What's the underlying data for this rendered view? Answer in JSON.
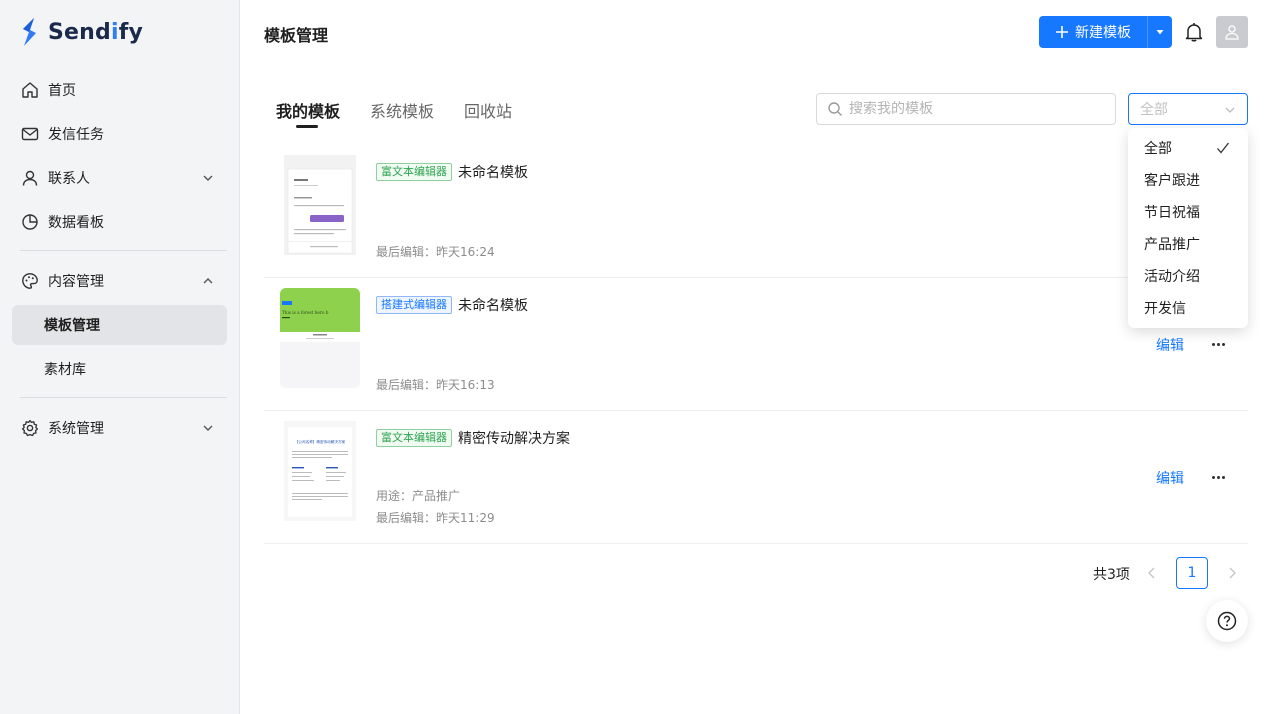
{
  "brand": {
    "name_prefix": "Send",
    "name_mid": "i",
    "name_suffix": "fy",
    "accent": "#2f7cf6"
  },
  "sidebar": {
    "items": [
      {
        "label": "首页",
        "icon": "home-icon"
      },
      {
        "label": "发信任务",
        "icon": "mail-icon"
      },
      {
        "label": "联系人",
        "icon": "user-icon",
        "expandable": true
      },
      {
        "label": "数据看板",
        "icon": "pie-chart-icon"
      },
      {
        "label": "内容管理",
        "icon": "palette-icon",
        "expanded": true
      },
      {
        "label": "模板管理",
        "sub": true,
        "active": true
      },
      {
        "label": "素材库",
        "sub": true
      },
      {
        "label": "系统管理",
        "icon": "gear-icon",
        "expandable": true
      }
    ]
  },
  "header": {
    "title": "模板管理",
    "new_button": "新建模板"
  },
  "tabs": [
    {
      "label": "我的模板",
      "active": true
    },
    {
      "label": "系统模板"
    },
    {
      "label": "回收站"
    }
  ],
  "search": {
    "placeholder": "搜索我的模板"
  },
  "filter": {
    "placeholder": "全部",
    "options": [
      "全部",
      "客户跟进",
      "节日祝福",
      "产品推广",
      "活动介绍",
      "开发信"
    ],
    "selected": "全部"
  },
  "templates": [
    {
      "tag": "富文本编辑器",
      "tag_color": "green",
      "name": "未命名模板",
      "last_edit": "最后编辑：昨天16:24"
    },
    {
      "tag": "搭建式编辑器",
      "tag_color": "blue",
      "name": "未命名模板",
      "last_edit": "最后编辑：昨天16:13",
      "edit": "编辑"
    },
    {
      "tag": "富文本编辑器",
      "tag_color": "green",
      "name": "精密传动解决方案",
      "usage": "用途：产品推广",
      "last_edit": "最后编辑：昨天11:29",
      "edit": "编辑"
    }
  ],
  "thumbs": {
    "t2_banner_text": "This is a forest hero b",
    "t3_heading": "【公司名称】精密传动解决方案"
  },
  "pagination": {
    "total": "共3项",
    "current": "1"
  }
}
